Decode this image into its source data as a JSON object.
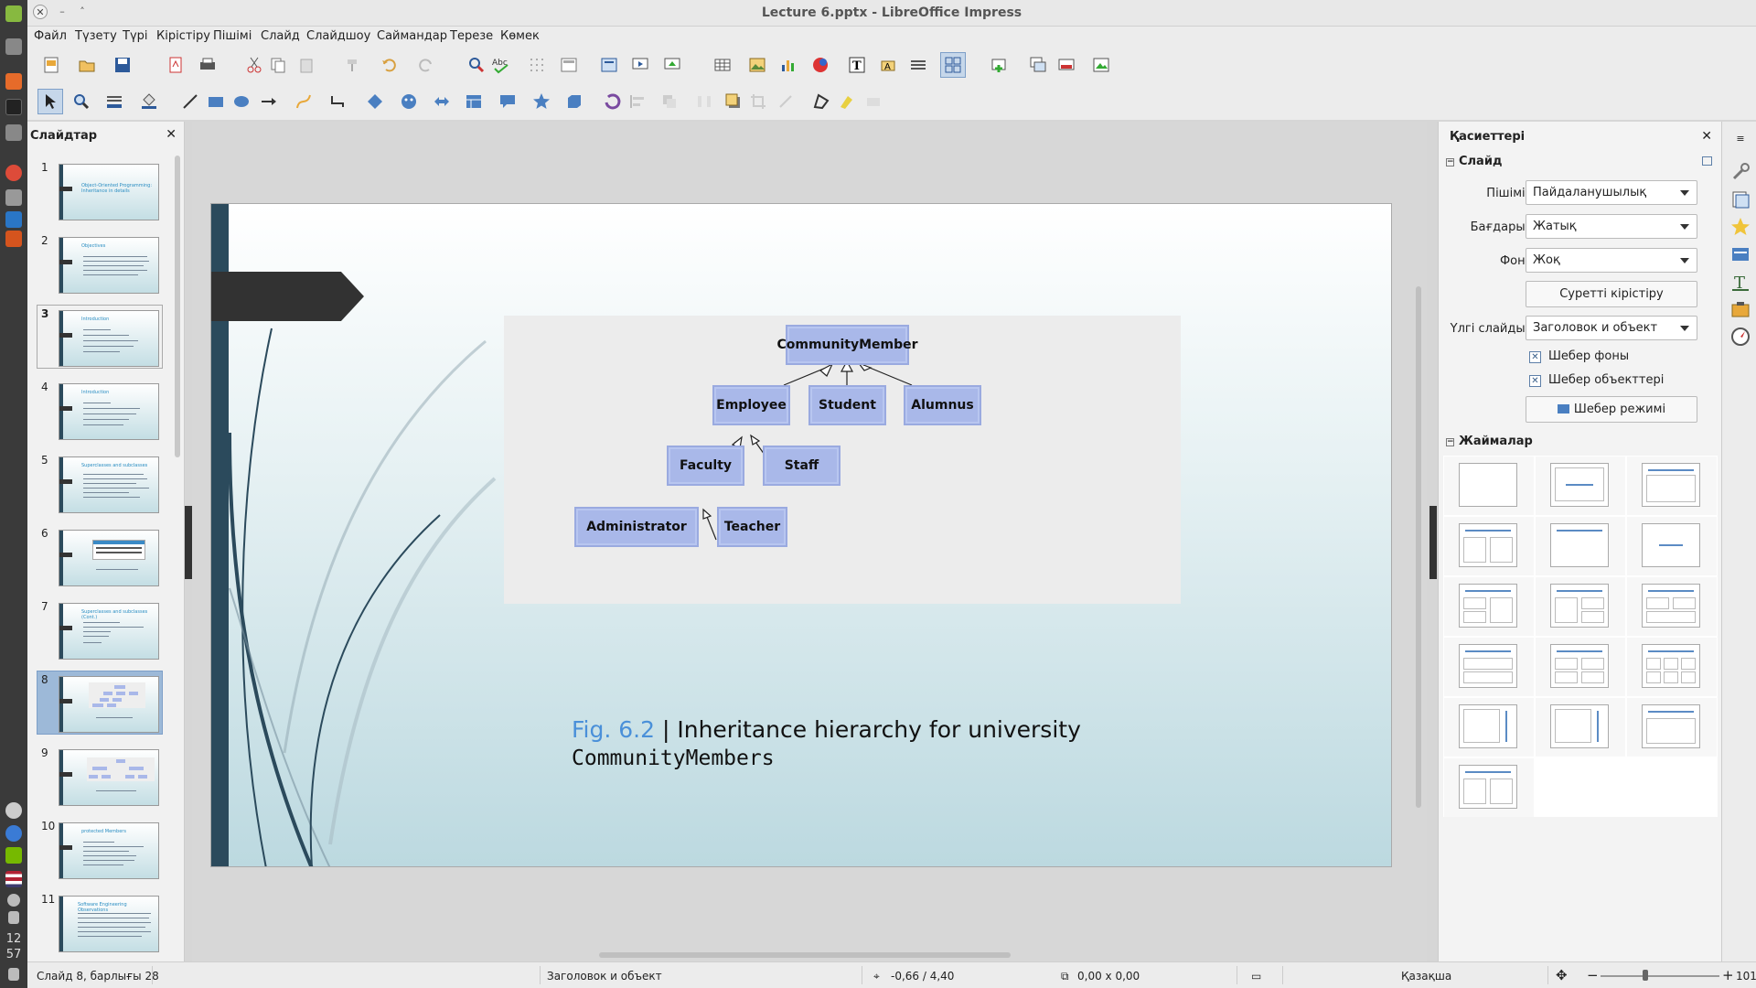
{
  "window": {
    "title": "Lecture 6.pptx - LibreOffice Impress"
  },
  "menu": [
    "Файл",
    "Түзету",
    "Түрі",
    "Кірістіру",
    "Пішімі",
    "Слайд",
    "Слайдшоу",
    "Саймандар",
    "Терезе",
    "Көмек"
  ],
  "slides_pane": {
    "title": "Слайдтар",
    "thumbnails": [
      {
        "num": "1",
        "title": "Object-Oriented Programming: Inheritance in details"
      },
      {
        "num": "2",
        "title": "Objectives"
      },
      {
        "num": "3",
        "title": "Introduction"
      },
      {
        "num": "4",
        "title": "Introduction"
      },
      {
        "num": "5",
        "title": "Superclasses and subclasses"
      },
      {
        "num": "6",
        "title": ""
      },
      {
        "num": "7",
        "title": "Superclasses and subclasses (Cont.)"
      },
      {
        "num": "8",
        "title": ""
      },
      {
        "num": "9",
        "title": ""
      },
      {
        "num": "10",
        "title": "protected Members"
      },
      {
        "num": "11",
        "title": "Software Engineering Observations"
      }
    ],
    "selected": "8"
  },
  "slide": {
    "nodes": {
      "community_member": "CommunityMember",
      "employee": "Employee",
      "student": "Student",
      "alumnus": "Alumnus",
      "faculty": "Faculty",
      "staff": "Staff",
      "administrator": "Administrator",
      "teacher": "Teacher"
    },
    "caption": {
      "fig": "Fig. 6.2",
      "sep": " | ",
      "text": "Inheritance hierarchy for university",
      "line2": "CommunityMembers"
    }
  },
  "sidebar": {
    "title": "Қасиеттері",
    "slide_section": "Слайд",
    "format_label": "Пішімі:",
    "format_value": "Пайдаланушылық",
    "orientation_label": "Бағдары:",
    "orientation_value": "Жатық",
    "background_label": "Фон:",
    "background_value": "Жоқ",
    "insert_image": "Суретті кірістіру",
    "master_label": "Үлгі слайды:",
    "master_value": "Заголовок и объект",
    "master_background": "Шебер фоны",
    "master_objects": "Шебер объекттері",
    "master_mode": "Шебер режимі",
    "layouts_section": "Жаймалар"
  },
  "status": {
    "slide": "Слайд 8, барлығы 28",
    "layout": "Заголовок и объект",
    "position": "-0,66 / 4,40",
    "size": "0,00 x 0,00",
    "language": "Қазақша",
    "zoom": "101%"
  },
  "system": {
    "time_h": "12",
    "time_m": "57"
  },
  "colors": {
    "accent": "#2b4a5c",
    "node_fill": "#a9b8e9",
    "caption_fig": "#4a90d9"
  }
}
